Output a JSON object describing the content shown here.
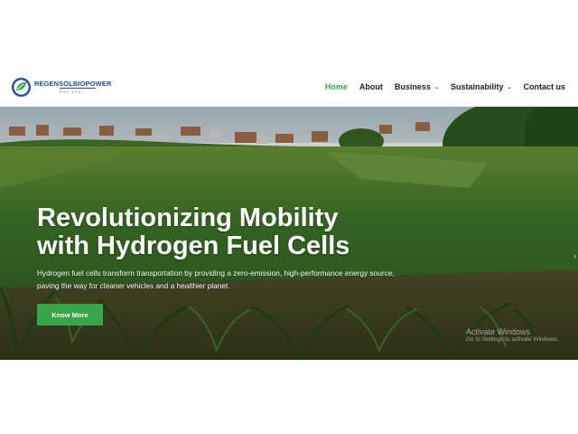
{
  "header": {
    "logo": {
      "name": "REGENSOLBIOPOWER",
      "sub": "PVT LTD"
    },
    "nav": [
      {
        "label": "Home",
        "active": true
      },
      {
        "label": "About"
      },
      {
        "label": "Business",
        "dropdown": true
      },
      {
        "label": "Sustainability",
        "dropdown": true
      },
      {
        "label": "Contact us"
      }
    ]
  },
  "hero": {
    "title_line1": "Revolutionizing Mobility",
    "title_line2": "with Hydrogen Fuel Cells",
    "description": "Hydrogen fuel cells transform transportation by providing a zero-emission, high-performance energy source, paving the way for cleaner vehicles and a healthier planet.",
    "button_label": "Know More",
    "background": "corn-field-photo"
  },
  "watermark": {
    "title": "Activate Windows",
    "subtitle": "Go to Settings to activate Windows."
  },
  "colors": {
    "accent": "#3aa64a",
    "logo_blue": "#1f4fa0",
    "text": "#222222"
  },
  "icons": [
    "logo-leaf-icon",
    "chevron-down-icon",
    "chevron-right-icon"
  ]
}
